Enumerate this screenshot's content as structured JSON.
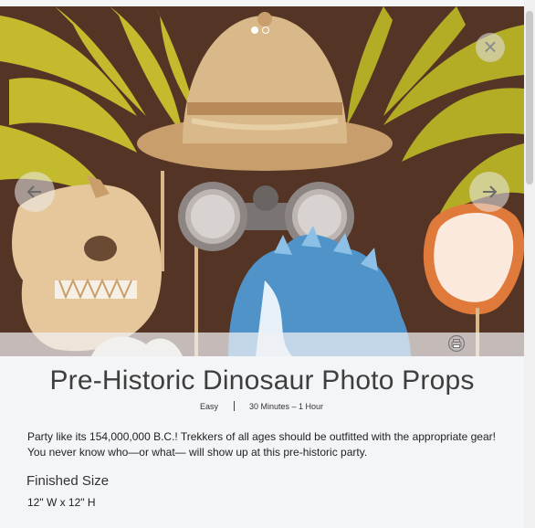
{
  "project": {
    "title": "Pre-Historic Dinosaur Photo Props",
    "difficulty": "Easy",
    "time": "30 Minutes – 1 Hour",
    "description": "Party like its 154,000,000 B.C.! Trekkers of all ages should be outfitted with the appropriate gear! You never know who—or what— will show up at this pre-historic party."
  },
  "finished_size": {
    "heading": "Finished Size",
    "value": "12\" W x 12\" H"
  },
  "carousel": {
    "slide_count": 2,
    "active_slide": 1,
    "prev_icon": "arrow-left-icon",
    "next_icon": "arrow-right-icon",
    "close_icon": "close-icon",
    "print_icon": "printer-icon"
  },
  "colors": {
    "wood_background": "#5a3a28",
    "fern_green": "#c9c22e",
    "hat_tan": "#d9b88a",
    "binocular_gray": "#8c8584",
    "dino_blue": "#4f93c9",
    "frame_orange": "#e07a3a",
    "panel_background": "#f4f5f7"
  }
}
